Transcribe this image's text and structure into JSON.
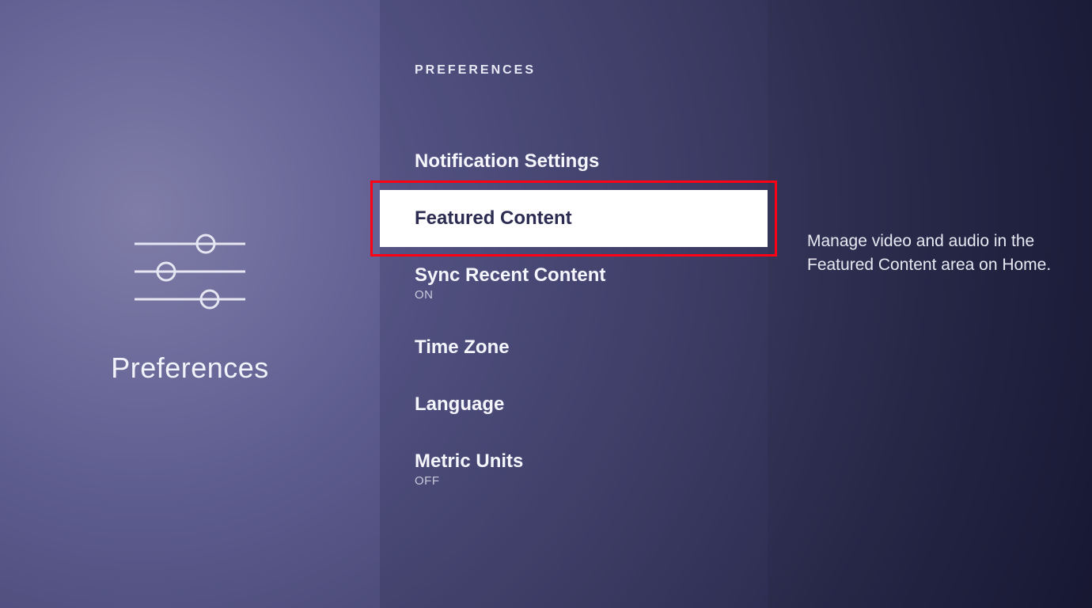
{
  "page": {
    "title": "Preferences",
    "section_header": "PREFERENCES"
  },
  "menu": {
    "items": [
      {
        "label": "Notification Settings",
        "subtext": ""
      },
      {
        "label": "Featured Content",
        "subtext": ""
      },
      {
        "label": "Sync Recent Content",
        "subtext": "ON"
      },
      {
        "label": "Time Zone",
        "subtext": ""
      },
      {
        "label": "Language",
        "subtext": ""
      },
      {
        "label": "Metric Units",
        "subtext": "OFF"
      }
    ],
    "selected_index": 1
  },
  "detail": {
    "description": "Manage video and audio in the Featured Content area on Home."
  },
  "highlight": {
    "visible": true
  }
}
